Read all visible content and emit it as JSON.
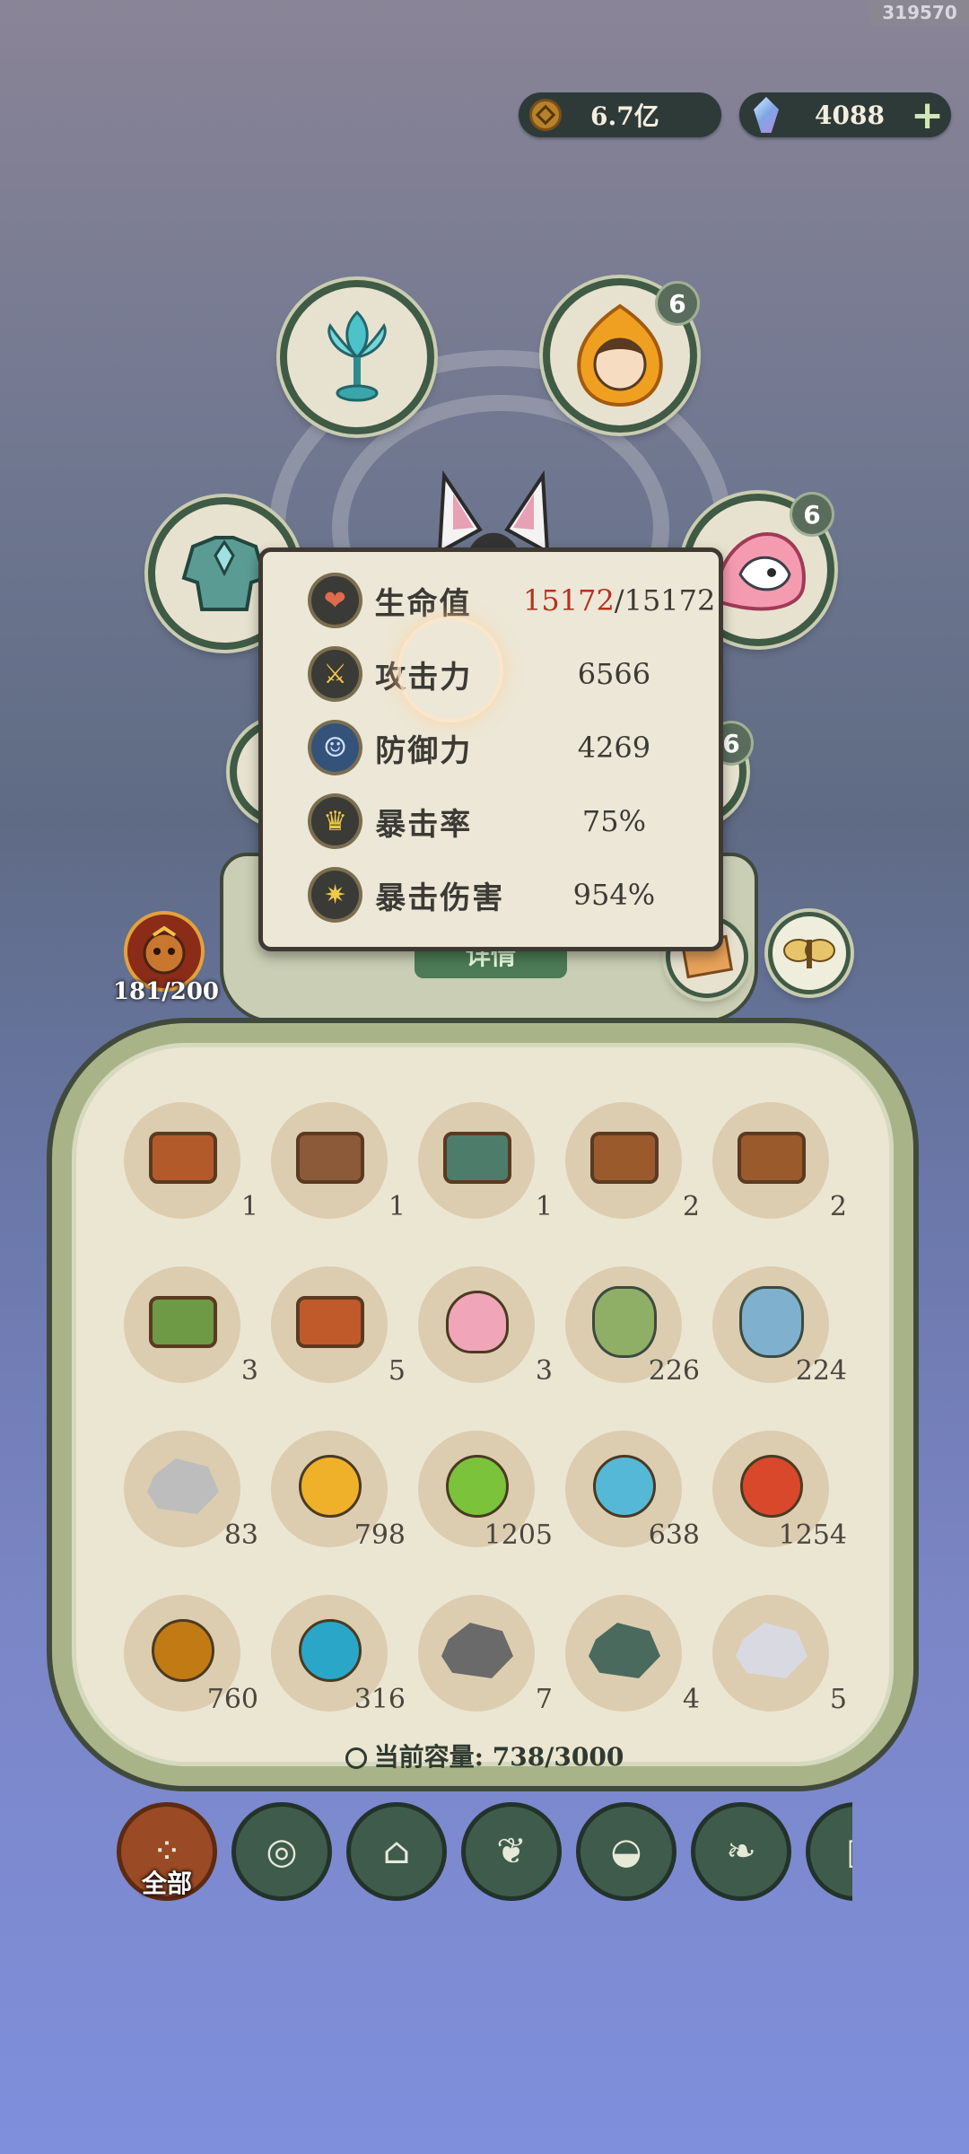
{
  "watermark": "319570",
  "currency": {
    "coins": {
      "value": "6.7亿",
      "icon": "coin-icon"
    },
    "gems": {
      "value": "4088",
      "icon": "gem-icon",
      "add_icon": "plus-icon"
    }
  },
  "equipment": {
    "slots": [
      {
        "name": "lotus-goblet",
        "icon": "lotus-cup-icon"
      },
      {
        "name": "fire-spirit-portrait",
        "icon": "fire-spirit-icon",
        "badge": "6"
      },
      {
        "name": "armor-piece",
        "icon": "armor-icon"
      },
      {
        "name": "dragon-spirit",
        "icon": "dragon-icon",
        "badge": "6"
      },
      {
        "name": "hidden-slot",
        "badge": "6"
      }
    ]
  },
  "stats": [
    {
      "label": "生命值",
      "value_current": "15172",
      "value_max": "/15172",
      "icon": "heart-icon"
    },
    {
      "label": "攻击力",
      "value": "6566",
      "icon": "sword-icon"
    },
    {
      "label": "防御力",
      "value": "4269",
      "icon": "person-shield-icon"
    },
    {
      "label": "暴击率",
      "value": "75%",
      "icon": "crit-rate-icon"
    },
    {
      "label": "暴击伤害",
      "value": "954%",
      "icon": "crit-damage-icon"
    }
  ],
  "detail_button": "详情",
  "level": {
    "value": "181/200",
    "icon": "monkey-avatar-icon"
  },
  "colors": {
    "accent_red": "#b5321f",
    "panel": "#ebe6d2",
    "frame_green": "#3f5a45"
  },
  "inventory": {
    "rows": [
      [
        {
          "icon": "chest-icon",
          "color": "#b35a2a",
          "count": "1"
        },
        {
          "icon": "chest-icon",
          "color": "#8c5a38",
          "count": "1"
        },
        {
          "icon": "chest-icon",
          "color": "#4d7d6a",
          "count": "1"
        },
        {
          "icon": "chest-icon",
          "color": "#9a5a2c",
          "count": "2"
        },
        {
          "icon": "chest-icon",
          "color": "#9a5a2c",
          "count": "2"
        }
      ],
      [
        {
          "icon": "green-chest-icon",
          "color": "#6e9a45",
          "count": "3"
        },
        {
          "icon": "ornate-chest-icon",
          "color": "#c05a2a",
          "count": "5"
        },
        {
          "icon": "lotus-icon",
          "color": "#f0a6b8",
          "count": "3"
        },
        {
          "icon": "green-pouch-icon",
          "color": "#8fae66",
          "count": "226"
        },
        {
          "icon": "blue-pouch-icon",
          "color": "#7fb1cf",
          "count": "224"
        }
      ],
      [
        {
          "icon": "grey-stone-icon",
          "color": "#bdbdbd",
          "count": "83"
        },
        {
          "icon": "gold-orb-icon",
          "color": "#f0b12a",
          "count": "798"
        },
        {
          "icon": "green-orb-icon",
          "color": "#7bc33a",
          "count": "1205"
        },
        {
          "icon": "blue-orb-icon",
          "color": "#54b8d6",
          "count": "638"
        },
        {
          "icon": "red-orb-icon",
          "color": "#d9482a",
          "count": "1254"
        }
      ],
      [
        {
          "icon": "amber-orb-icon",
          "color": "#c27a14",
          "count": "760"
        },
        {
          "icon": "spirit-blue-orb-icon",
          "color": "#2aa6c8",
          "count": "316"
        },
        {
          "icon": "dark-ore-icon",
          "color": "#6a6a6a",
          "count": "7"
        },
        {
          "icon": "jade-ore-icon",
          "color": "#4a6a5e",
          "count": "4"
        },
        {
          "icon": "crystal-icon",
          "color": "#d9d9e2",
          "count": "5"
        }
      ]
    ]
  },
  "capacity": {
    "label": "当前容量:",
    "value": "738/3000"
  },
  "tabs": [
    {
      "label": "全部",
      "icon": "all-grid-icon",
      "active": true
    },
    {
      "icon": "wood-log-icon"
    },
    {
      "icon": "house-icon"
    },
    {
      "icon": "herb-icon"
    },
    {
      "icon": "food-bowl-icon"
    },
    {
      "icon": "leaf-map-icon"
    },
    {
      "icon": "scroll-icon"
    }
  ]
}
